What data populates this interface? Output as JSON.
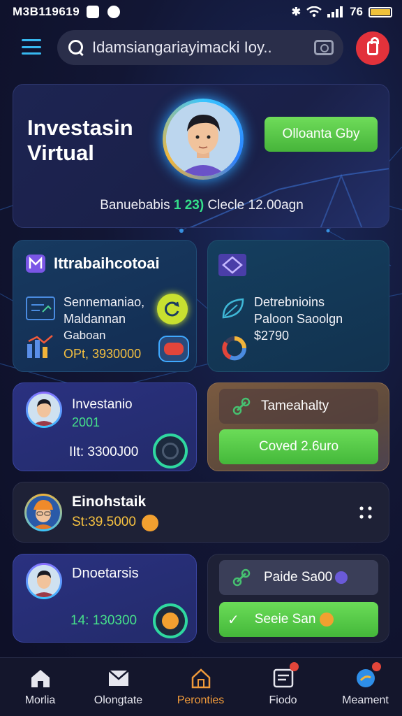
{
  "status_bar": {
    "time": "M3B119619",
    "signal": "76"
  },
  "header": {
    "search_text": "Idamsiangariayimacki Ioy.."
  },
  "hero": {
    "title": "Investasin Virtual",
    "cta_label": "Olloanta Gby",
    "summary_prefix": "Banuebabis",
    "summary_highlight": "1 23)",
    "summary_suffix": "Clecle 12.00agn"
  },
  "card_left_top": {
    "title": "Ittrabaihcotoai",
    "lines": [
      "Sennemaniao,",
      "Maldannan",
      "Gaboan"
    ],
    "value": "OPt, 3930000"
  },
  "card_right_top": {
    "lines": [
      "Detrebnioins",
      "Paloon Saoolgn"
    ],
    "value": "$2790"
  },
  "card_investanto": {
    "name": "Investanio",
    "year": "2001",
    "amount": "IIt: 3300J00"
  },
  "card_tameahalty": {
    "label": "Tameahalty",
    "button_label": "Coved 2.6uro"
  },
  "card_einohstaik": {
    "name": "Einohstaik",
    "amount": "St:39.5000"
  },
  "card_dnoetarsis": {
    "name": "Dnoetarsis",
    "amount": "14: 130300"
  },
  "card_paide": {
    "label": "Paide Sa00",
    "button_label": "Seeie San"
  },
  "bottom_nav": [
    {
      "label": "Morlia"
    },
    {
      "label": "Olongtate"
    },
    {
      "label": "Peronties"
    },
    {
      "label": "Fiodo"
    },
    {
      "label": "Meament"
    }
  ],
  "colors": {
    "accent_green": "#46e08a",
    "brand_orange": "#f09a3a",
    "alert_red": "#e2323b"
  }
}
